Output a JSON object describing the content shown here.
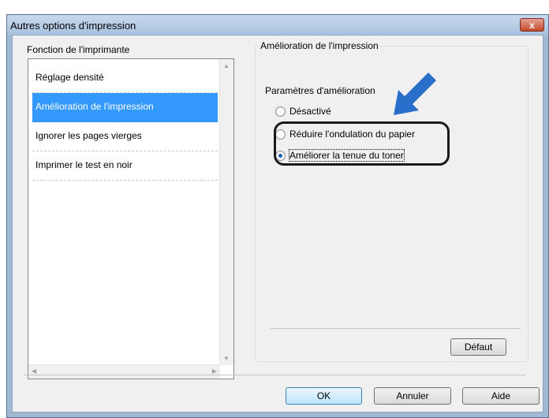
{
  "window": {
    "title": "Autres options d'impression",
    "close_label": "x"
  },
  "left": {
    "group_label": "Fonction de l'imprimante",
    "items": [
      {
        "label": "Réglage densité"
      },
      {
        "label": "Amélioration de l'impression"
      },
      {
        "label": "Ignorer les pages vierges"
      },
      {
        "label": "Imprimer le test en noir"
      }
    ],
    "selected_index": 1
  },
  "right": {
    "group_label": "Amélioration de l'impression",
    "sub_title": "Paramètres d'amélioration",
    "options": [
      {
        "label": "Désactivé",
        "checked": false
      },
      {
        "label": "Réduire l'ondulation du papier",
        "checked": false
      },
      {
        "label": "Améliorer la tenue du toner",
        "checked": true
      }
    ],
    "default_button": "Défaut"
  },
  "footer": {
    "ok": "OK",
    "cancel": "Annuler",
    "help": "Aide"
  },
  "colors": {
    "selection": "#3399ff",
    "arrow": "#2a6fc9"
  }
}
